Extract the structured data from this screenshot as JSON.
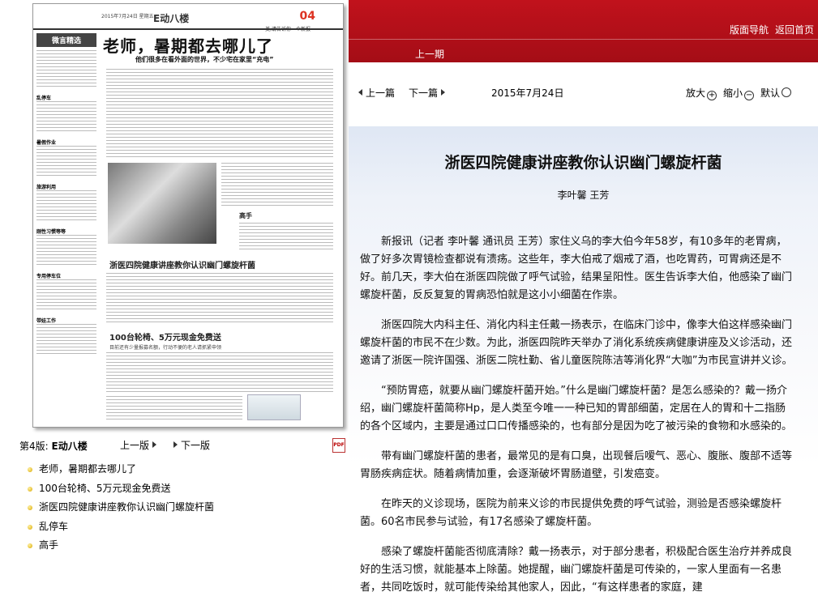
{
  "window": {
    "title": "浙医四院健康讲座教你认识幽门螺旋杆菌"
  },
  "top_nav": {
    "layout_nav": "版面导航",
    "back_home": "返回首页",
    "period": "上一期"
  },
  "toolbar": {
    "prev_article": "上一篇",
    "next_article": "下一篇",
    "date": "2015年7月24日",
    "zoom_in": "放大",
    "zoom_out": "缩小",
    "default": "默认",
    "zoom_in_symbol": "+",
    "zoom_out_symbol": "−"
  },
  "newspaper_thumb": {
    "date_line": "2015年7月24日 星期五",
    "section": "E动八楼",
    "page_number": "04",
    "slogan": "美,请告诉你一个新报",
    "sidebar_title": "微言精选",
    "sidebar_items": [
      "乱停车",
      "暑假作业",
      "旅游利用",
      "刚性习惯等等",
      "专用停车位",
      "带娃工作"
    ],
    "headline": "老师，暑期都去哪儿了",
    "subheadline": "他们很多在看外面的世界，不少宅在家里“充电”",
    "photo_caption": "高手",
    "story2_title": "浙医四院健康讲座教你认识幽门螺旋杆菌",
    "story3_title": "100台轮椅、5万元现金免费送",
    "story3_sub": "目前还有少量报募名额，行动不便的老人请抓紧申领"
  },
  "page_nav": {
    "page_prefix": "第4版:",
    "page_name": "E动八楼",
    "prev_page": "上一版",
    "next_page": "下一版",
    "pdf_label": "PDF"
  },
  "articles": [
    "老师，暑期都去哪儿了",
    "100台轮椅、5万元现金免费送",
    "浙医四院健康讲座教你认识幽门螺旋杆菌",
    "乱停车",
    "高手"
  ],
  "article": {
    "title": "浙医四院健康讲座教你认识幽门螺旋杆菌",
    "authors": "李叶馨  王芳",
    "paragraphs": [
      "新报讯（记者 李叶馨 通讯员 王芳）家住义乌的李大伯今年58岁，有10多年的老胃病，做了好多次胃镜检查都说有溃疡。这些年，李大伯戒了烟戒了酒，也吃胃药，可胃病还是不好。前几天，李大伯在浙医四院做了呼气试验，结果呈阳性。医生告诉李大伯，他感染了幽门螺旋杆菌，反反复复的胃病恐怕就是这小小细菌在作祟。",
      "浙医四院大内科主任、消化内科主任戴一扬表示，在临床门诊中，像李大伯这样感染幽门螺旋杆菌的市民不在少数。为此，浙医四院昨天举办了消化系统疾病健康讲座及义诊活动，还邀请了浙医一院许国强、浙医二院杜勤、省儿童医院陈洁等消化界“大咖”为市民宣讲并义诊。",
      "“预防胃癌，就要从幽门螺旋杆菌开始。”什么是幽门螺旋杆菌？是怎么感染的？戴一扬介绍，幽门螺旋杆菌简称Hp，是人类至今唯一一种已知的胃部细菌，定居在人的胃和十二指肠的各个区域内，主要是通过口口传播感染的，也有部分是因为吃了被污染的食物和水感染的。",
      "带有幽门螺旋杆菌的患者，最常见的是有口臭，出现餐后嗳气、恶心、腹胀、腹部不适等胃肠疾病症状。随着病情加重，会逐渐破坏胃肠道壁，引发癌变。",
      "在昨天的义诊现场，医院为前来义诊的市民提供免费的呼气试验，测验是否感染螺旋杆菌。60名市民参与试验，有17名感染了螺旋杆菌。",
      "感染了螺旋杆菌能否彻底清除？戴一扬表示，对于部分患者，积极配合医生治疗并养成良好的生活习惯，就能基本上除菌。她提醒，幽门螺旋杆菌是可传染的，一家人里面有一名患者，共同吃饭时，就可能传染给其他家人，因此，“有这样患者的家庭，建"
    ]
  },
  "colors": {
    "header_red": "#b3101a",
    "panel_blue": "#dfe7f4",
    "list_bullet": "#d9a800"
  }
}
